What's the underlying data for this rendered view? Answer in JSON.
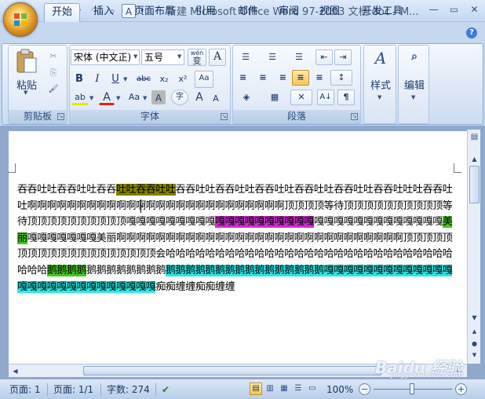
{
  "title_bar": {
    "title": "新建 Microsoft Office Word 97-2003 文档.doc - M...",
    "qat": [
      "save-icon",
      "undo-icon",
      "redo-icon",
      "print-preview-icon",
      "format-icon"
    ],
    "undo_glyph": "↶",
    "redo_glyph": "↷",
    "save_glyph": "▣",
    "preview_glyph": "⌕",
    "format_glyph": "A",
    "dropdown_glyph": "▾",
    "minimize_glyph": "—",
    "restore_glyph": "▭",
    "close_glyph": "✕"
  },
  "tabs": [
    "开始",
    "插入",
    "页面布局",
    "引用",
    "邮件",
    "审阅",
    "视图",
    "开发工具"
  ],
  "help_glyph": "?",
  "ribbon": {
    "clipboard": {
      "label": "剪贴板",
      "paste": "粘贴",
      "cut_glyph": "✂",
      "copy_glyph": "⎘",
      "painter_glyph": "🖌"
    },
    "font": {
      "label": "字体",
      "font_name": "宋体 (中文正)",
      "font_size": "五号",
      "wen": "wén",
      "wen_char": "变",
      "a_box": "A",
      "bold": "B",
      "italic": "I",
      "underline": "U",
      "strike": "abc",
      "subscript": "x₂",
      "superscript": "x²",
      "clear_format": "Aa",
      "highlight": "ab",
      "font_color": "A",
      "change_case": "Aa",
      "char_shading": "A",
      "enclose": "字",
      "grow": "A",
      "shrink": "A"
    },
    "paragraph": {
      "label": "段落",
      "bullets_glyph": "☰",
      "numbering_glyph": "☰",
      "multilevel_glyph": "☰",
      "decrease_indent": "⇤",
      "increase_indent": "⇥",
      "align_left": "≡",
      "align_center": "≡",
      "align_right": "≡",
      "justify": "≡",
      "distribute": "≡",
      "line_spacing": "↕",
      "shading": "◈",
      "borders": "▦",
      "asian_layout": "✕",
      "sort": "A↓",
      "show_marks": "¶"
    },
    "styles": {
      "label": "样式",
      "glyph": "A"
    },
    "editing": {
      "label": "编辑",
      "glyph": "ᴬᴬ"
    }
  },
  "document": {
    "segments": [
      {
        "t": "吞吞吐吐吞吞吐吐吞吞",
        "hl": ""
      },
      {
        "t": "吐吐吞吞吐吐",
        "hl": "olive"
      },
      {
        "t": "吞吞吐吐吞吞吐吐吞吞吐吐吞吞吐吐吞吞吐吐吞吞吐吐吐吞吞吐吐啊啊啊啊啊啊啊啊啊啊啊啊啊啊啊啊啊啊啊啊啊啊啊啊啊啊顶顶顶顶等待顶顶顶顶顶顶顶顶顶顶等待顶顶顶顶顶顶顶顶顶",
        "hl": ""
      },
      {
        "t": "顶嘎嘎嘎嘎嘎嘎嘎嘎嘎",
        "hl": ""
      },
      {
        "t": "嘎嘎嘎嘎嘎嘎嘎嘎嘎嘎",
        "hl": "magenta"
      },
      {
        "t": "嘎嘎嘎嘎嘎嘎嘎嘎嘎嘎嘎嘎嘎",
        "hl": ""
      },
      {
        "t": "美丽",
        "hl": "green"
      },
      {
        "t": "嘎嘎嘎嘎嘎嘎嘎美丽啊啊啊啊啊啊啊啊啊啊啊啊啊啊啊啊啊啊啊啊啊啊啊啊啊啊啊啊啊顶顶顶顶顶顶顶顶顶顶顶顶顶顶顶顶顶顶顶会哈哈哈哈哈哈哈哈哈哈哈哈哈哈哈哈哈哈哈哈哈哈哈哈哈哈哈哈哈哈哈哈",
        "hl": ""
      },
      {
        "t": "鹅鹅鹅鹅",
        "hl": "green"
      },
      {
        "t": "鹅鹅鹅鹅鹅鹅鹅鹅",
        "hl": ""
      },
      {
        "t": "鹅鹅鹅鹅鹅鹅鹅鹅鹅鹅鹅鹅鹅鹅鹅鹅嘎嘎嘎嘎嘎嘎嘎嘎嘎嘎嘎嘎嘎嘎嘎嘎嘎嘎嘎嘎嘎嘎嘎嘎嘎嘎嘎",
        "hl": "cyan"
      },
      {
        "t": "痴痴缠缠痴痴缠缠",
        "hl": ""
      }
    ]
  },
  "status_bar": {
    "page": "页面: 1",
    "pages": "页面: 1/1",
    "words": "字数: 274",
    "proof_glyph": "✔",
    "zoom": "100%",
    "zoom_out": "−",
    "zoom_in": "+"
  },
  "watermark": {
    "text": "Baidu 经验",
    "url": "jingyan.baidu.com"
  },
  "colors": {
    "olive": "#808000",
    "magenta": "#d12fd1",
    "green": "#46c81e",
    "cyan": "#2de6e6"
  }
}
